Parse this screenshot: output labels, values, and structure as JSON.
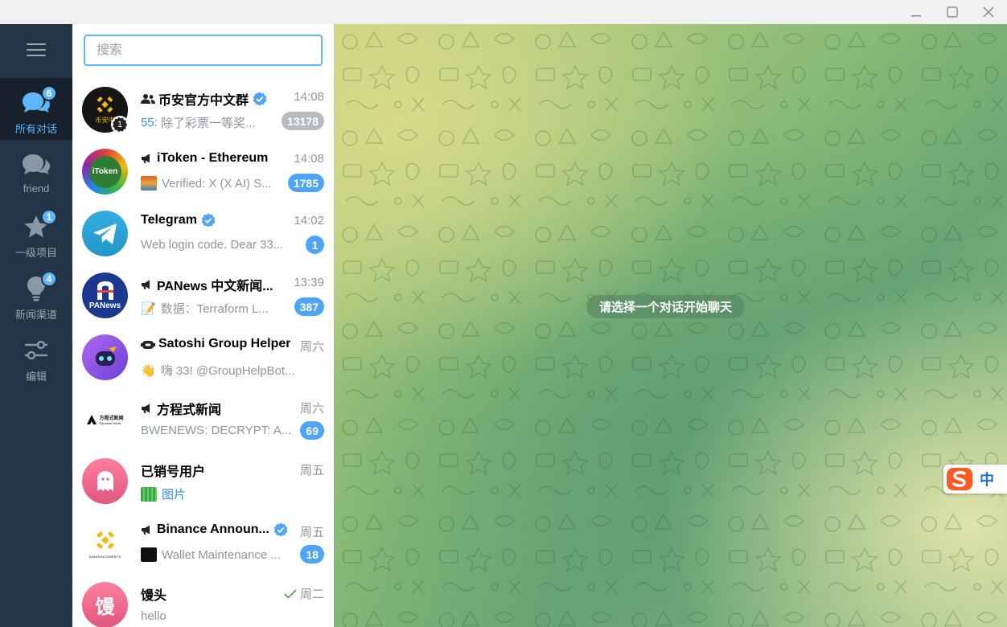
{
  "window": {
    "controls": {
      "minimize": "—",
      "maximize": "☐",
      "close": "✕"
    }
  },
  "nav": {
    "items": [
      {
        "label": "所有对话",
        "badge": "6",
        "icon": "chat-bubbles-icon"
      },
      {
        "label": "friend",
        "badge": "",
        "icon": "chat-bubbles-icon"
      },
      {
        "label": "一级项目",
        "badge": "1",
        "icon": "star-icon"
      },
      {
        "label": "新闻渠道",
        "badge": "4",
        "icon": "lightbulb-icon"
      },
      {
        "label": "编辑",
        "badge": "",
        "icon": "sliders-icon"
      }
    ]
  },
  "search": {
    "placeholder": "搜索",
    "value": ""
  },
  "chats": [
    {
      "name": "币安官方中文群",
      "type": "group",
      "verified": true,
      "time": "14:08",
      "sender": "55:",
      "message": "除了彩票一等奖...",
      "count": "13178",
      "muted": true,
      "avatar_text": "币安中",
      "story_count": "1"
    },
    {
      "name": "iToken - Ethereum",
      "type": "channel",
      "verified": false,
      "time": "14:08",
      "message": "Verified: X (X AI)  S...",
      "count": "1785",
      "muted": false,
      "avatar_text": "iToken"
    },
    {
      "name": "Telegram",
      "type": "user",
      "verified": true,
      "time": "14:02",
      "message": "Web login code. Dear 33...",
      "count": "1",
      "muted": false
    },
    {
      "name": "PANews 中文新闻...",
      "type": "channel",
      "verified": false,
      "time": "13:39",
      "message": "数据：Terraform L...",
      "count": "387",
      "muted": false,
      "avatar_text": "PANews"
    },
    {
      "name": "Satoshi Group Helper",
      "type": "bot",
      "verified": false,
      "time": "周六",
      "message": "嗨 33!    @GroupHelpBot...",
      "count": "",
      "muted": false
    },
    {
      "name": "方程式新闻",
      "type": "channel",
      "verified": false,
      "time": "周六",
      "message": "BWENEWS: DECRYPT: A...",
      "count": "69",
      "muted": false,
      "avatar_text": "方程式新闻",
      "avatar_subtext": "Equation News"
    },
    {
      "name": "已销号用户",
      "type": "user",
      "verified": false,
      "time": "周五",
      "message": "图片",
      "count": "",
      "muted": false
    },
    {
      "name": "Binance Announ...",
      "type": "channel",
      "verified": true,
      "time": "周五",
      "message": "Wallet Maintenance ...",
      "count": "18",
      "muted": false,
      "avatar_text": "ANNOUNCEMENTS"
    },
    {
      "name": "馒头",
      "type": "user",
      "verified": false,
      "time": "周二",
      "message": "hello",
      "count": "",
      "muted": false,
      "avatar_text": "馒",
      "read": true
    }
  ],
  "main": {
    "empty_text": "请选择一个对话开始聊天"
  },
  "ime": {
    "label": "中"
  },
  "colors": {
    "accent": "#5eb5f7",
    "nav_bg": "#243447",
    "nav_active": "#17212b",
    "muted_badge": "#b5bbc0"
  }
}
